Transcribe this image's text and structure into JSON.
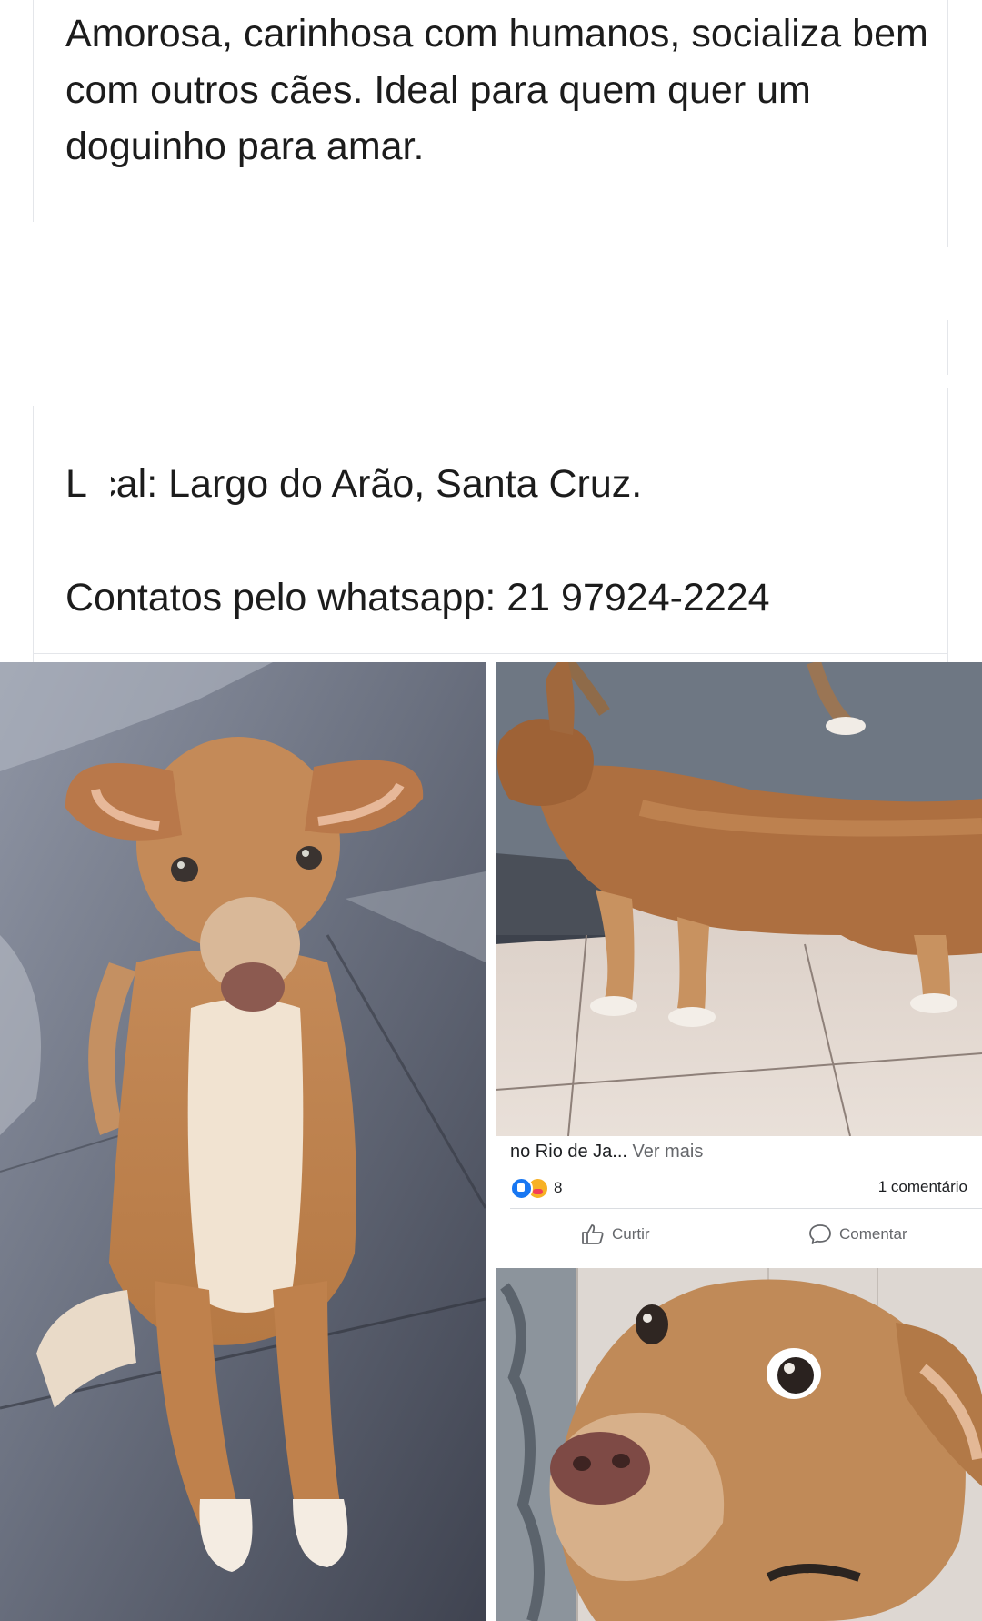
{
  "post": {
    "description": "Amorosa, carinhosa com humanos, socializa bem com outros cães. Ideal para quem quer um doguinho para amar.",
    "location": "L  cal: Largo do Arão,  Santa Cruz.",
    "contact": "Contatos pelo whatsapp: 21 97924-2224"
  },
  "screenshot_card": {
    "snippet": "no Rio de Ja...",
    "see_more": "Ver mais",
    "reaction_count": "8",
    "comment_count": "1 comentário",
    "like_label": "Curtir",
    "comment_label": "Comentar",
    "icons": [
      "like-reaction-icon",
      "care-reaction-icon",
      "thumbs-up-icon",
      "speech-bubble-icon"
    ],
    "accent": "#1877f2"
  },
  "photos": [
    {
      "subject": "dog sitting on slate floor",
      "name": "photo-dog-sitting"
    },
    {
      "subject": "dog standing side view on tiles",
      "name": "photo-dog-standing"
    },
    {
      "subject": "dog close-up face",
      "name": "photo-dog-closeup"
    }
  ]
}
